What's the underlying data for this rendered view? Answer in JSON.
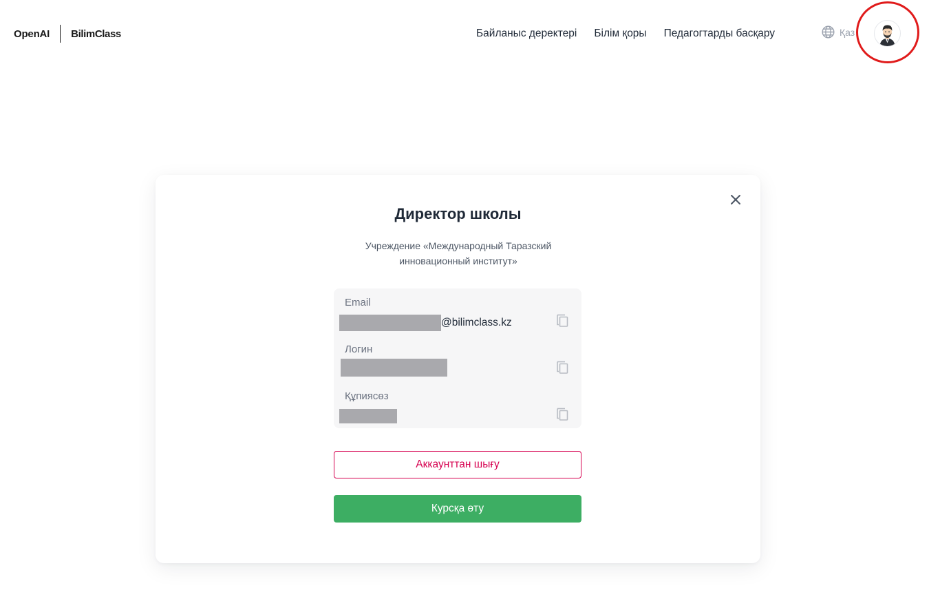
{
  "header": {
    "logo_left": "OpenAI",
    "logo_right": "BilimClass",
    "nav": [
      {
        "label": "Байланыс деректері"
      },
      {
        "label": "Білім қоры"
      },
      {
        "label": "Педагогтарды басқару"
      }
    ],
    "language": {
      "label": "Қаз",
      "icon": "globe-icon"
    },
    "avatar": {
      "icon": "user-avatar-icon",
      "highlight_color": "#e01b1b"
    }
  },
  "modal": {
    "title": "Директор школы",
    "subtitle": "Учреждение «Международный Таразский инновационный институт»",
    "close_icon": "close-icon",
    "fields": [
      {
        "label": "Email",
        "value_suffix": "@bilimclass.kz",
        "redacted": true
      },
      {
        "label": "Логин",
        "value_suffix": "",
        "redacted": true
      },
      {
        "label": "Құпиясөз",
        "value_suffix": "",
        "redacted": true
      }
    ],
    "logout_label": "Аккаунттан шығу",
    "course_label": "Курсқа өту"
  },
  "colors": {
    "logout": "#d6004f",
    "course": "#3dae63",
    "info_bg": "#f6f6f7",
    "redaction": "#a9a9ad"
  }
}
